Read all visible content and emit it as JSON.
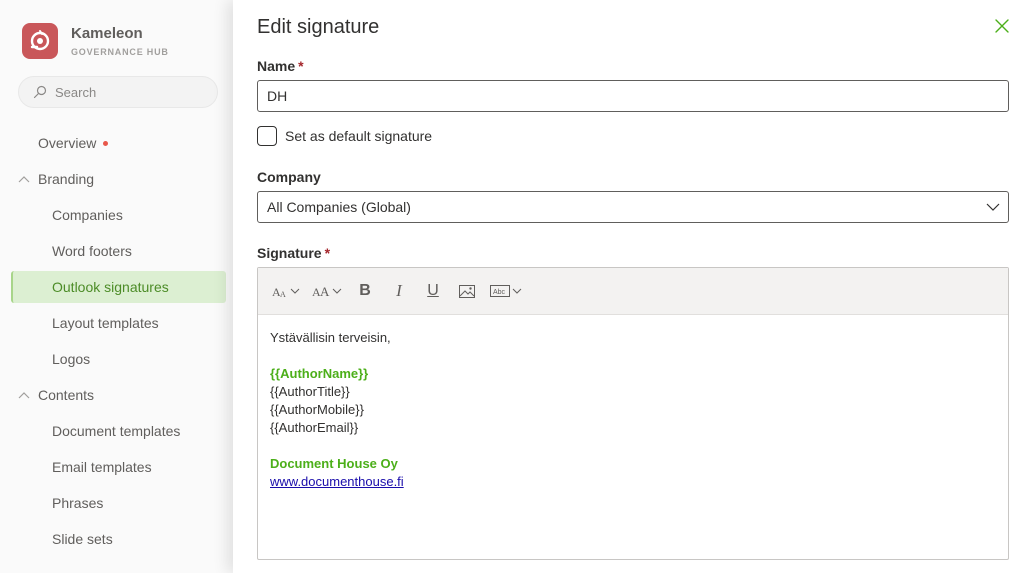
{
  "brand": {
    "name": "Kameleon",
    "subtitle": "GOVERNANCE HUB"
  },
  "search": {
    "placeholder": "Search"
  },
  "nav": {
    "overview": "Overview",
    "branding": {
      "label": "Branding",
      "items": [
        "Companies",
        "Word footers",
        "Outlook signatures",
        "Layout templates",
        "Logos"
      ]
    },
    "contents": {
      "label": "Contents",
      "items": [
        "Document templates",
        "Email templates",
        "Phrases",
        "Slide sets"
      ]
    },
    "active": "Outlook signatures"
  },
  "panel": {
    "title": "Edit signature",
    "name_label": "Name",
    "name_value": "DH",
    "required_mark": "*",
    "default_checkbox_label": "Set as default signature",
    "company_label": "Company",
    "company_value": "All Companies (Global)",
    "signature_label": "Signature"
  },
  "toolbar": {
    "font_size_icon": "font-size-icon",
    "font_family_icon": "font-family-icon",
    "bold_label": "B",
    "italic_label": "I",
    "underline_label": "U",
    "image_icon": "image-icon",
    "text_field_label": "Abc"
  },
  "signature": {
    "greeting": "Ystävällisin terveisin,",
    "author_name": "{{AuthorName}}",
    "author_title": "{{AuthorTitle}}",
    "author_mobile": "{{AuthorMobile}}",
    "author_email": "{{AuthorEmail}}",
    "company": "Document House Oy",
    "website": "www.documenthouse.fi"
  },
  "colors": {
    "accent_green": "#4caf1a",
    "logo_red": "#c9575a",
    "active_bg": "#dcefd2",
    "link": "#1a0dab"
  }
}
